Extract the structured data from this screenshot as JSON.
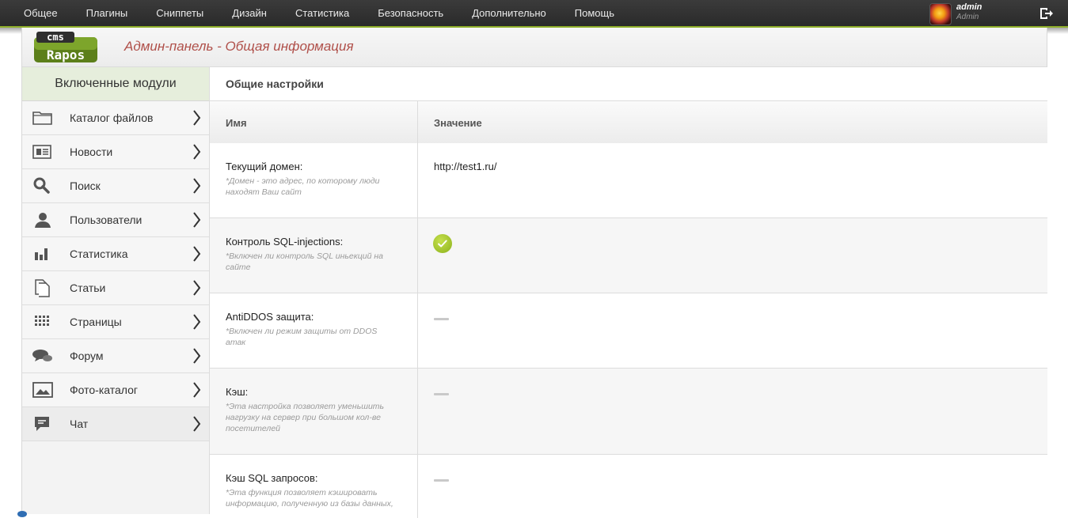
{
  "topnav": {
    "items": [
      "Общее",
      "Плагины",
      "Сниппеты",
      "Дизайн",
      "Статистика",
      "Безопасность",
      "Дополнительно",
      "Помощь"
    ],
    "user": {
      "name": "admin",
      "role": "Admin"
    },
    "logout_icon": "logout-icon",
    "accent": "#8faf2a"
  },
  "header": {
    "logo_text_top": "cms",
    "logo_text_bottom": "Rapos",
    "title": "Админ-панель - Общая информация",
    "title_color": "#b0504a"
  },
  "sidebar": {
    "heading": "Включенные модули",
    "items": [
      {
        "label": "Каталог файлов",
        "icon": "folder-icon"
      },
      {
        "label": "Новости",
        "icon": "newspaper-icon"
      },
      {
        "label": "Поиск",
        "icon": "search-icon"
      },
      {
        "label": "Пользователи",
        "icon": "user-icon"
      },
      {
        "label": "Статистика",
        "icon": "bar-chart-icon"
      },
      {
        "label": "Статьи",
        "icon": "documents-icon"
      },
      {
        "label": "Страницы",
        "icon": "grid-icon"
      },
      {
        "label": "Форум",
        "icon": "chat-bubbles-icon"
      },
      {
        "label": "Фото-каталог",
        "icon": "image-icon"
      },
      {
        "label": "Чат",
        "icon": "message-icon"
      }
    ]
  },
  "main": {
    "section_title": "Общие настройки",
    "columns": {
      "name": "Имя",
      "value": "Значение"
    },
    "rows": [
      {
        "name": "Текущий домен:",
        "desc": "*Домен - это адрес, по которому люди находят Ваш сайт",
        "value": "http://test1.ru/",
        "state": "text"
      },
      {
        "name": "Контроль SQL-injections:",
        "desc": "*Включен ли контроль SQL иньекций на сайте",
        "value": "",
        "state": "on"
      },
      {
        "name": "AntiDDOS защита:",
        "desc": "*Включен ли режим защиты от DDOS атак",
        "value": "",
        "state": "off"
      },
      {
        "name": "Кэш:",
        "desc": "*Эта настройка позволяет уменьшить нагрузку на сервер при большом кол-ве посетителей",
        "value": "",
        "state": "off"
      },
      {
        "name": "Кэш SQL запросов:",
        "desc": "*Эта функция позволяет кэшировать информацию, полученную из базы данных,",
        "value": "",
        "state": "off"
      }
    ]
  }
}
